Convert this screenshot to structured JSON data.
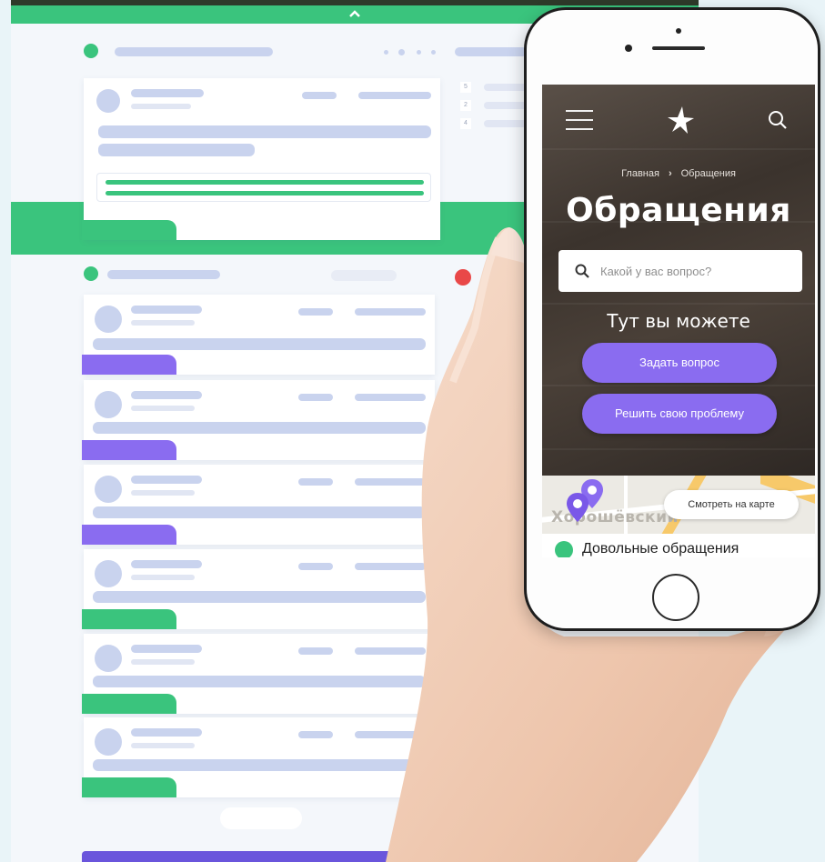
{
  "phone_screen": {
    "breadcrumbs": [
      "Главная",
      "Обращения"
    ],
    "breadcrumb_separator": "›",
    "title": "Обращения",
    "search": {
      "placeholder": "Какой у вас вопрос?"
    },
    "subtitle": "Тут вы можете",
    "buttons": {
      "ask": "Задать вопрос",
      "solve": "Решить свою проблему"
    },
    "map": {
      "label": "Хорошёвский",
      "button": "Смотреть на карте"
    },
    "section_title": "Довольные обращения"
  },
  "desktop_mockup": {
    "stat_numbers": [
      "5",
      "2",
      "4"
    ]
  },
  "colors": {
    "accent_green": "#3ac47d",
    "accent_purple": "#8a6cf0",
    "placeholder_bar": "#c9d3ee",
    "alert_red": "#e94848"
  },
  "icons": {
    "menu": "hamburger-icon",
    "logo": "star-logo-icon",
    "search": "magnifier-icon",
    "map_pin": "map-pin-icon",
    "collapse": "chevron-up-icon"
  }
}
